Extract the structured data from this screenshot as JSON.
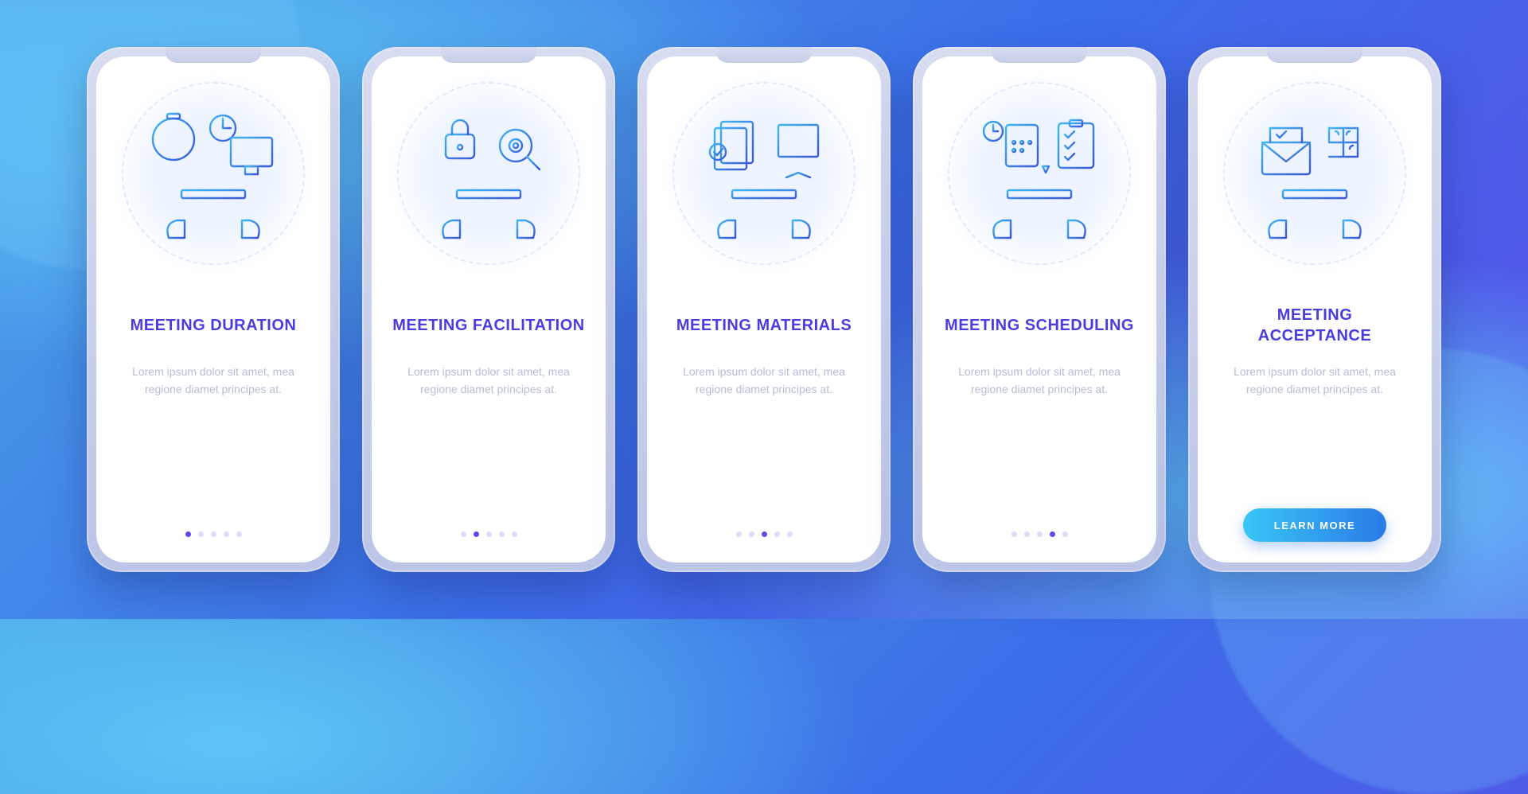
{
  "colors": {
    "heading": "#4a3de0",
    "body": "#b6bdd4",
    "dot_active": "#5a4de8",
    "cta_grad_from": "#38c6f4",
    "cta_grad_to": "#2a7be8"
  },
  "screens": [
    {
      "title": "MEETING DURATION",
      "body": "Lorem ipsum dolor sit amet, mea regione diamet principes at.",
      "active_index": 0,
      "icon": "duration"
    },
    {
      "title": "MEETING FACILITATION",
      "body": "Lorem ipsum dolor sit amet, mea regione diamet principes at.",
      "active_index": 1,
      "icon": "facilitation"
    },
    {
      "title": "MEETING MATERIALS",
      "body": "Lorem ipsum dolor sit amet, mea regione diamet principes at.",
      "active_index": 2,
      "icon": "materials"
    },
    {
      "title": "MEETING SCHEDULING",
      "body": "Lorem ipsum dolor sit amet, mea regione diamet principes at.",
      "active_index": 3,
      "icon": "scheduling"
    },
    {
      "title": "MEETING ACCEPTANCE",
      "body": "Lorem ipsum dolor sit amet, mea regione diamet principes at.",
      "active_index": 4,
      "icon": "acceptance"
    }
  ],
  "dot_count": 5,
  "cta_label": "LEARN MORE"
}
